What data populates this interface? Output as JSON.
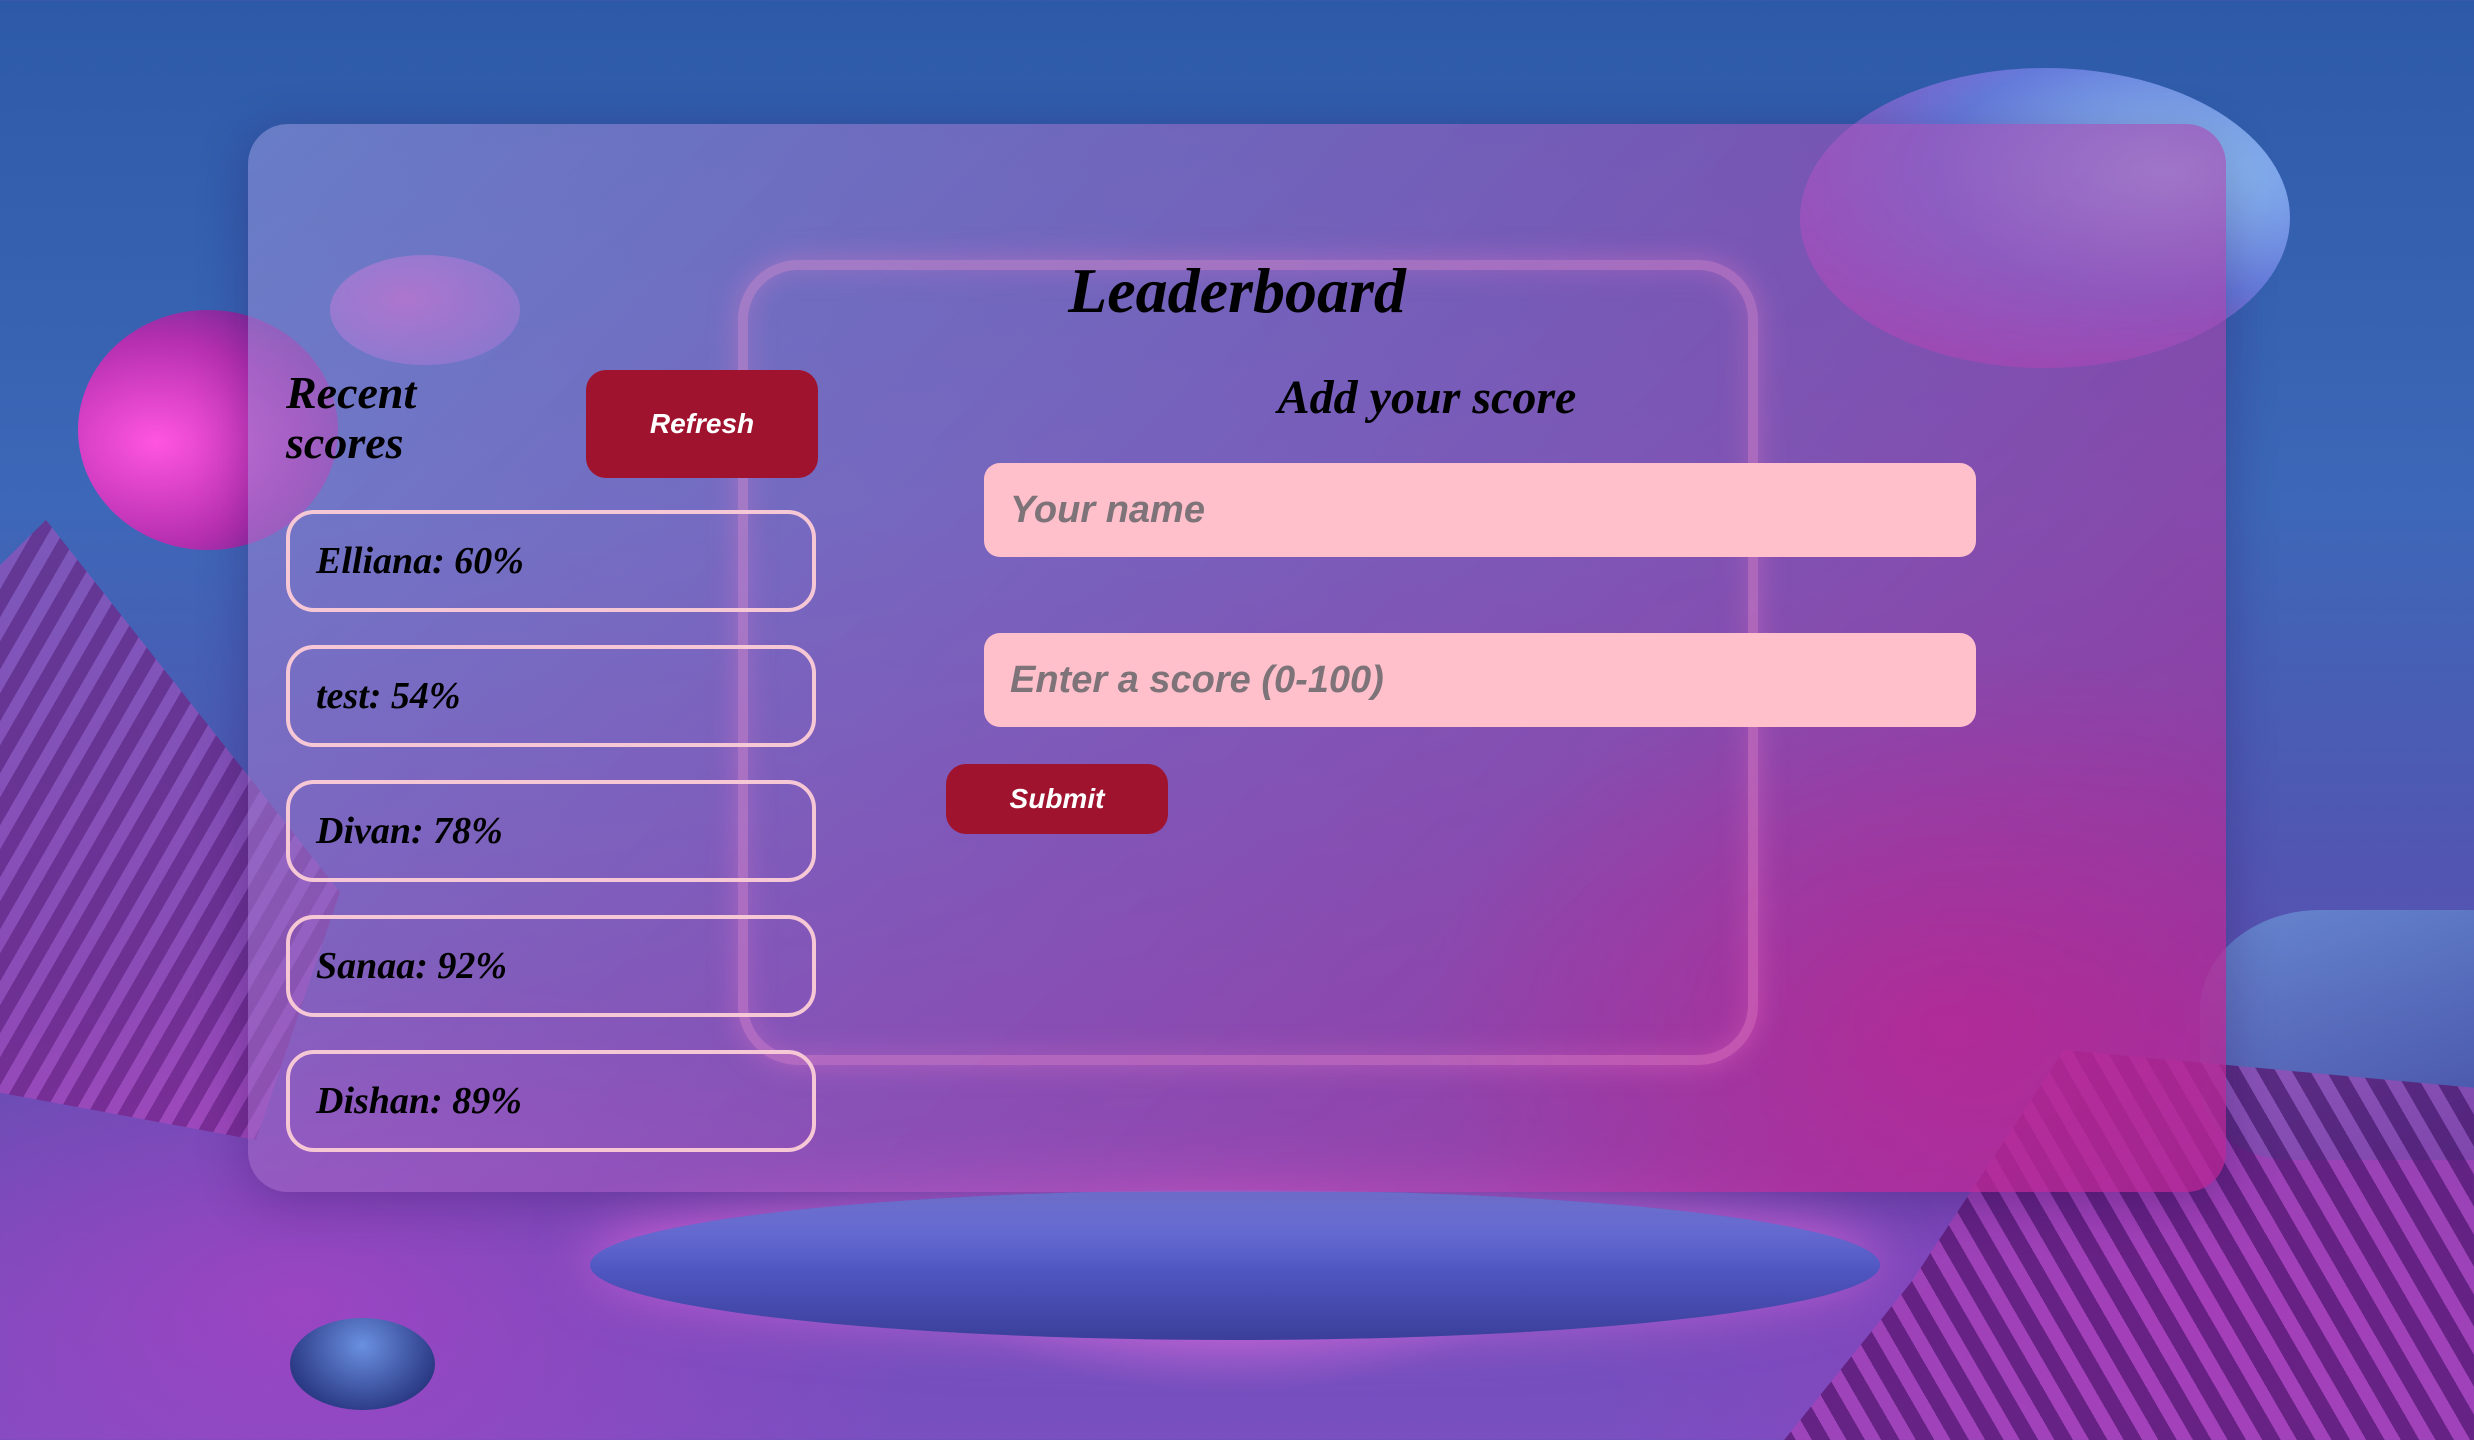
{
  "title": "Leaderboard",
  "recent": {
    "heading": "Recent scores",
    "refresh_label": "Refresh",
    "scores": [
      "Elliana: 60%",
      "test: 54%",
      "Divan: 78%",
      "Sanaa: 92%",
      "Dishan: 89%"
    ]
  },
  "form": {
    "heading": "Add your score",
    "name_placeholder": "Your name",
    "score_placeholder": "Enter a score (0-100)",
    "submit_label": "Submit"
  },
  "colors": {
    "button": "#a0132f",
    "input_bg": "#ffc0cb",
    "item_border": "#f6c7d4"
  }
}
